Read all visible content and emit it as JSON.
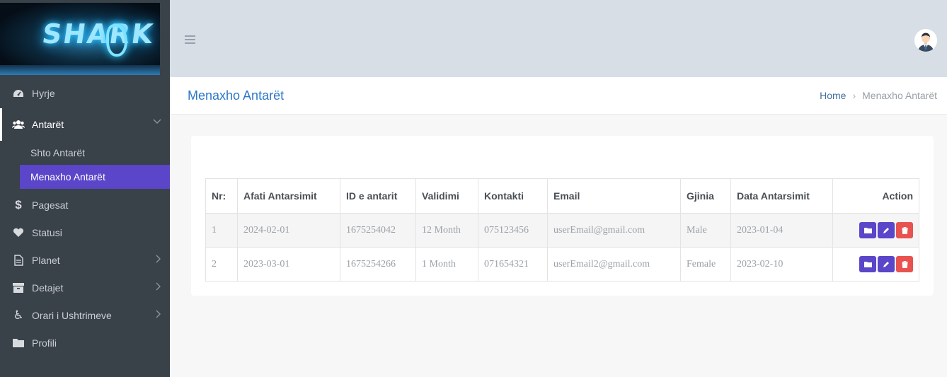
{
  "sidebar": {
    "logo_text": "SHARK",
    "items": [
      {
        "label": "Hyrje",
        "icon": "dashboard-icon"
      },
      {
        "label": "Antarët",
        "icon": "users-icon"
      },
      {
        "label": "Pagesat",
        "icon": "dollar-icon"
      },
      {
        "label": "Statusi",
        "icon": "heart-icon"
      },
      {
        "label": "Planet",
        "icon": "document-icon"
      },
      {
        "label": "Detajet",
        "icon": "archive-icon"
      },
      {
        "label": "Orari i Ushtrimeve",
        "icon": "wheelchair-icon"
      },
      {
        "label": "Profili",
        "icon": "folder-icon"
      }
    ],
    "subitems": [
      {
        "label": "Shto Antarët"
      },
      {
        "label": "Menaxho Antarët"
      }
    ]
  },
  "header": {
    "title": "Menaxho Antarët",
    "breadcrumb": {
      "home": "Home",
      "current": "Menaxho Antarët"
    }
  },
  "table": {
    "headers": [
      "Nr:",
      "Afati Antarsimit",
      "ID e antarit",
      "Validimi",
      "Kontakti",
      "Email",
      "Gjinia",
      "Data Antarsimit",
      "Action"
    ],
    "rows": [
      [
        "1",
        "2024-02-01",
        "1675254042",
        "12 Month",
        "075123456",
        "userEmail@gmail.com",
        "Male",
        "2023-01-04"
      ],
      [
        "2",
        "2023-03-01",
        "1675254266",
        "1 Month",
        "071654321",
        "userEmail2@gmail.com",
        "Female",
        "2023-02-10"
      ]
    ],
    "actions": [
      "view-icon",
      "edit-icon",
      "delete-icon"
    ]
  },
  "colors": {
    "accent": "#5b45c8",
    "danger": "#e8534f",
    "sidebar": "#394149",
    "title": "#2b77c9"
  }
}
